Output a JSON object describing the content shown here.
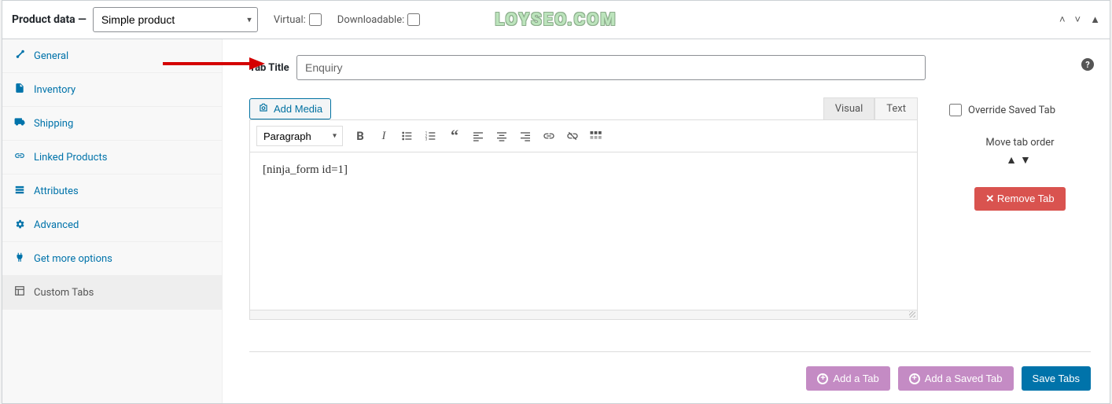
{
  "header": {
    "title": "Product data —",
    "product_type": "Simple product",
    "virtual_label": "Virtual:",
    "downloadable_label": "Downloadable:",
    "watermark": "LOYSEO.COM"
  },
  "sidebar": {
    "items": [
      {
        "label": "General",
        "icon": "wrench"
      },
      {
        "label": "Inventory",
        "icon": "note"
      },
      {
        "label": "Shipping",
        "icon": "truck"
      },
      {
        "label": "Linked Products",
        "icon": "link"
      },
      {
        "label": "Attributes",
        "icon": "list"
      },
      {
        "label": "Advanced",
        "icon": "gear"
      },
      {
        "label": "Get more options",
        "icon": "plug"
      },
      {
        "label": "Custom Tabs",
        "icon": "layout"
      }
    ],
    "active_index": 7
  },
  "tab_title": {
    "label": "Tab Title",
    "value": "Enquiry"
  },
  "editor": {
    "add_media": "Add Media",
    "tabs": {
      "visual": "Visual",
      "text": "Text",
      "active": "visual"
    },
    "format": "Paragraph",
    "content": "[ninja_form id=1]"
  },
  "side_panel": {
    "override": "Override Saved Tab",
    "move_label": "Move tab order",
    "remove": "Remove Tab"
  },
  "footer": {
    "add_tab": "Add a Tab",
    "add_saved": "Add a Saved Tab",
    "save": "Save Tabs"
  }
}
